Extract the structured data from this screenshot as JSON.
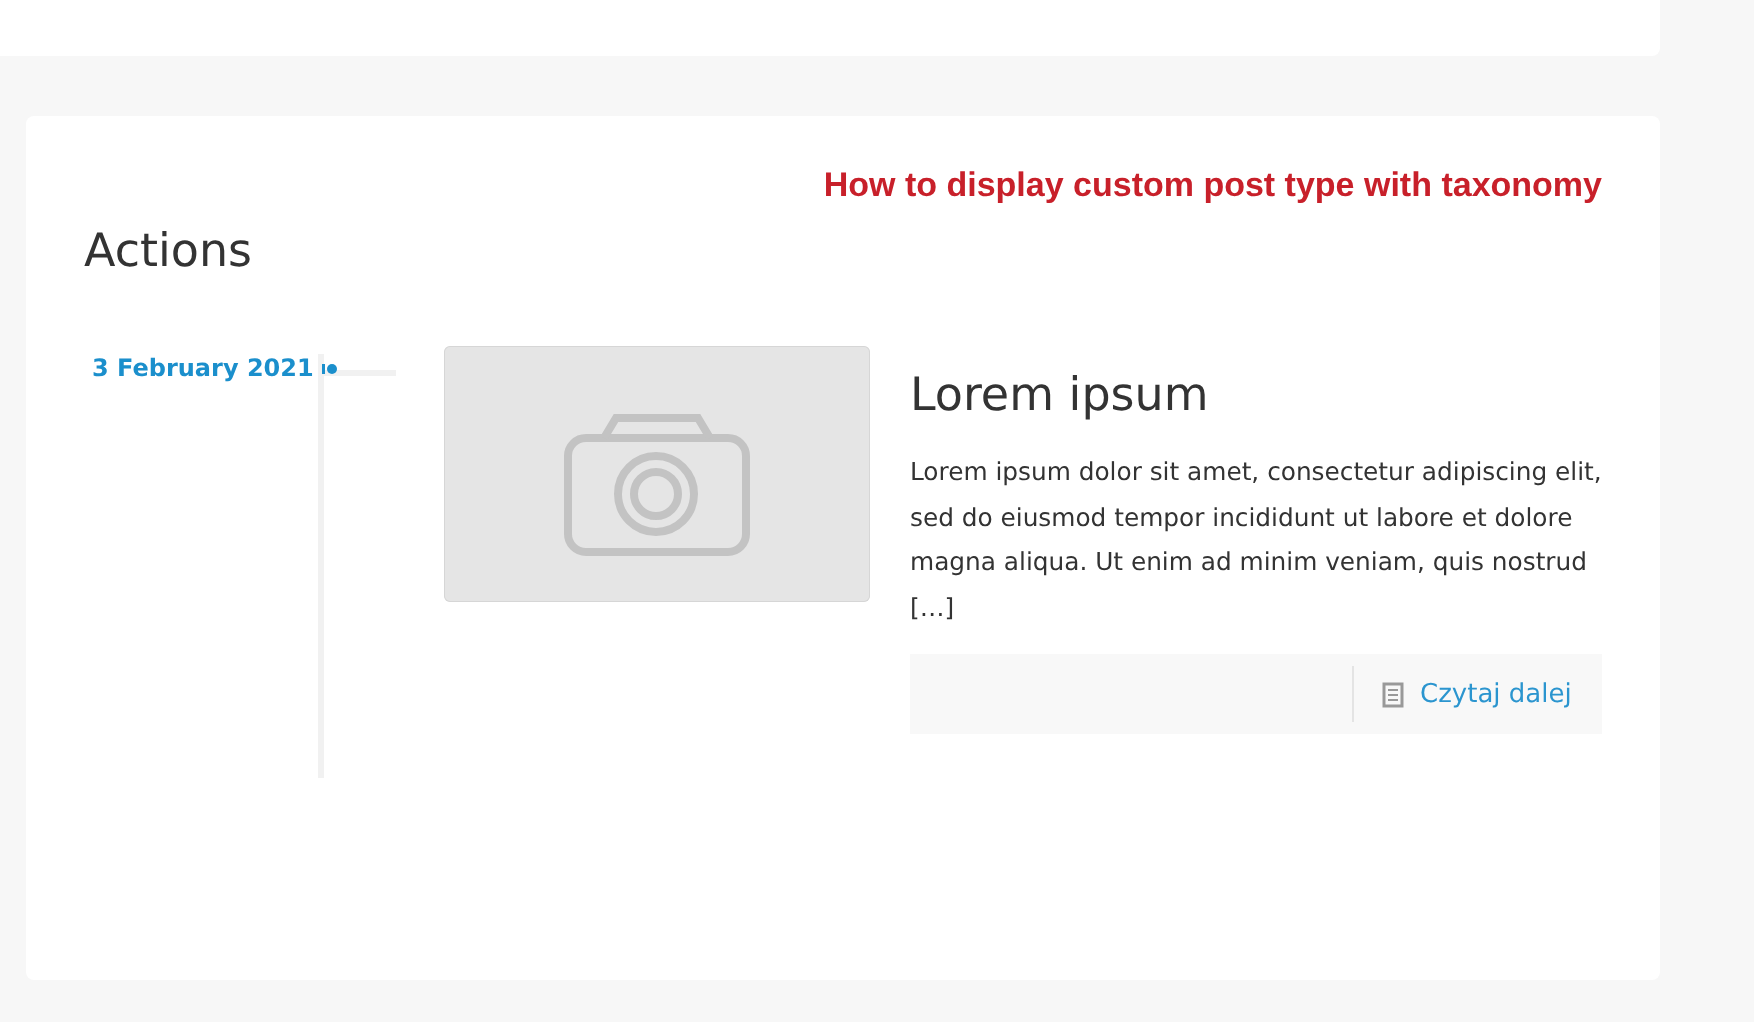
{
  "annotation": "How to display custom post type with taxonomy",
  "section": {
    "title": "Actions"
  },
  "posts": [
    {
      "date": "3 February 2021",
      "title": "Lorem ipsum",
      "excerpt": "Lorem ipsum dolor sit amet, consectetur adipiscing elit, sed do eiusmod tempor incididunt ut labore et dolore magna aliqua. Ut enim ad minim veniam, quis nostrud […]",
      "read_more": "Czytaj dalej"
    }
  ]
}
